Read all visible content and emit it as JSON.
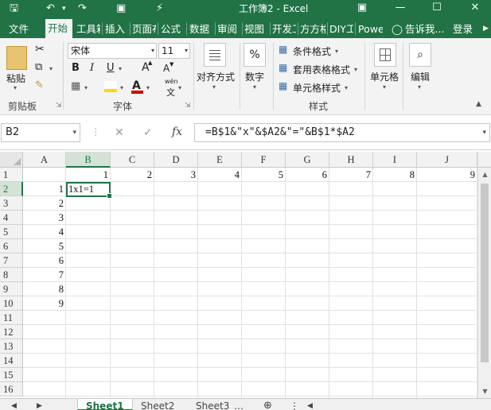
{
  "window": {
    "title": "工作簿2 - Excel",
    "accent": "#217346"
  },
  "ribbon_tabs": [
    "文件",
    "开始",
    "工具箱",
    "插入",
    "页面布局",
    "公式",
    "数据",
    "审阅",
    "视图",
    "开发工具",
    "方方格子",
    "DIY工具箱",
    "Power"
  ],
  "tell_me": "告诉我...",
  "login": "登录",
  "clipboard": {
    "paste": "粘贴",
    "label": "剪贴板"
  },
  "font": {
    "name": "宋体",
    "size": "11",
    "bold": "B",
    "italic": "I",
    "underline": "U",
    "grow": "A",
    "shrink": "A",
    "wen": "wén",
    "wen_char": "文",
    "label": "字体"
  },
  "alignment": {
    "label": "对齐方式"
  },
  "number": {
    "label": "数字",
    "symbol": "%"
  },
  "styles": {
    "conditional": "条件格式",
    "table": "套用表格格式",
    "cell": "单元格样式",
    "label": "样式"
  },
  "cells": {
    "label": "单元格"
  },
  "editing": {
    "label": "编辑"
  },
  "formula_bar": {
    "name_box": "B2",
    "formula": "=B$1&\"x\"&$A2&\"=\"&B$1*$A2",
    "fx": "fx"
  },
  "columns": [
    "A",
    "B",
    "C",
    "D",
    "E",
    "F",
    "G",
    "H",
    "I",
    "J"
  ],
  "rows": [
    "1",
    "2",
    "3",
    "4",
    "5",
    "6",
    "7",
    "8",
    "9",
    "10",
    "11",
    "12",
    "13",
    "14",
    "15",
    "16"
  ],
  "row1_values": [
    "",
    "1",
    "2",
    "3",
    "4",
    "5",
    "6",
    "7",
    "8",
    "9"
  ],
  "colA_values": [
    "",
    "1",
    "2",
    "3",
    "4",
    "5",
    "6",
    "7",
    "8",
    "9"
  ],
  "b2_value": "1x1=1",
  "sheets": [
    "Sheet1",
    "Sheet2",
    "Sheet3"
  ]
}
